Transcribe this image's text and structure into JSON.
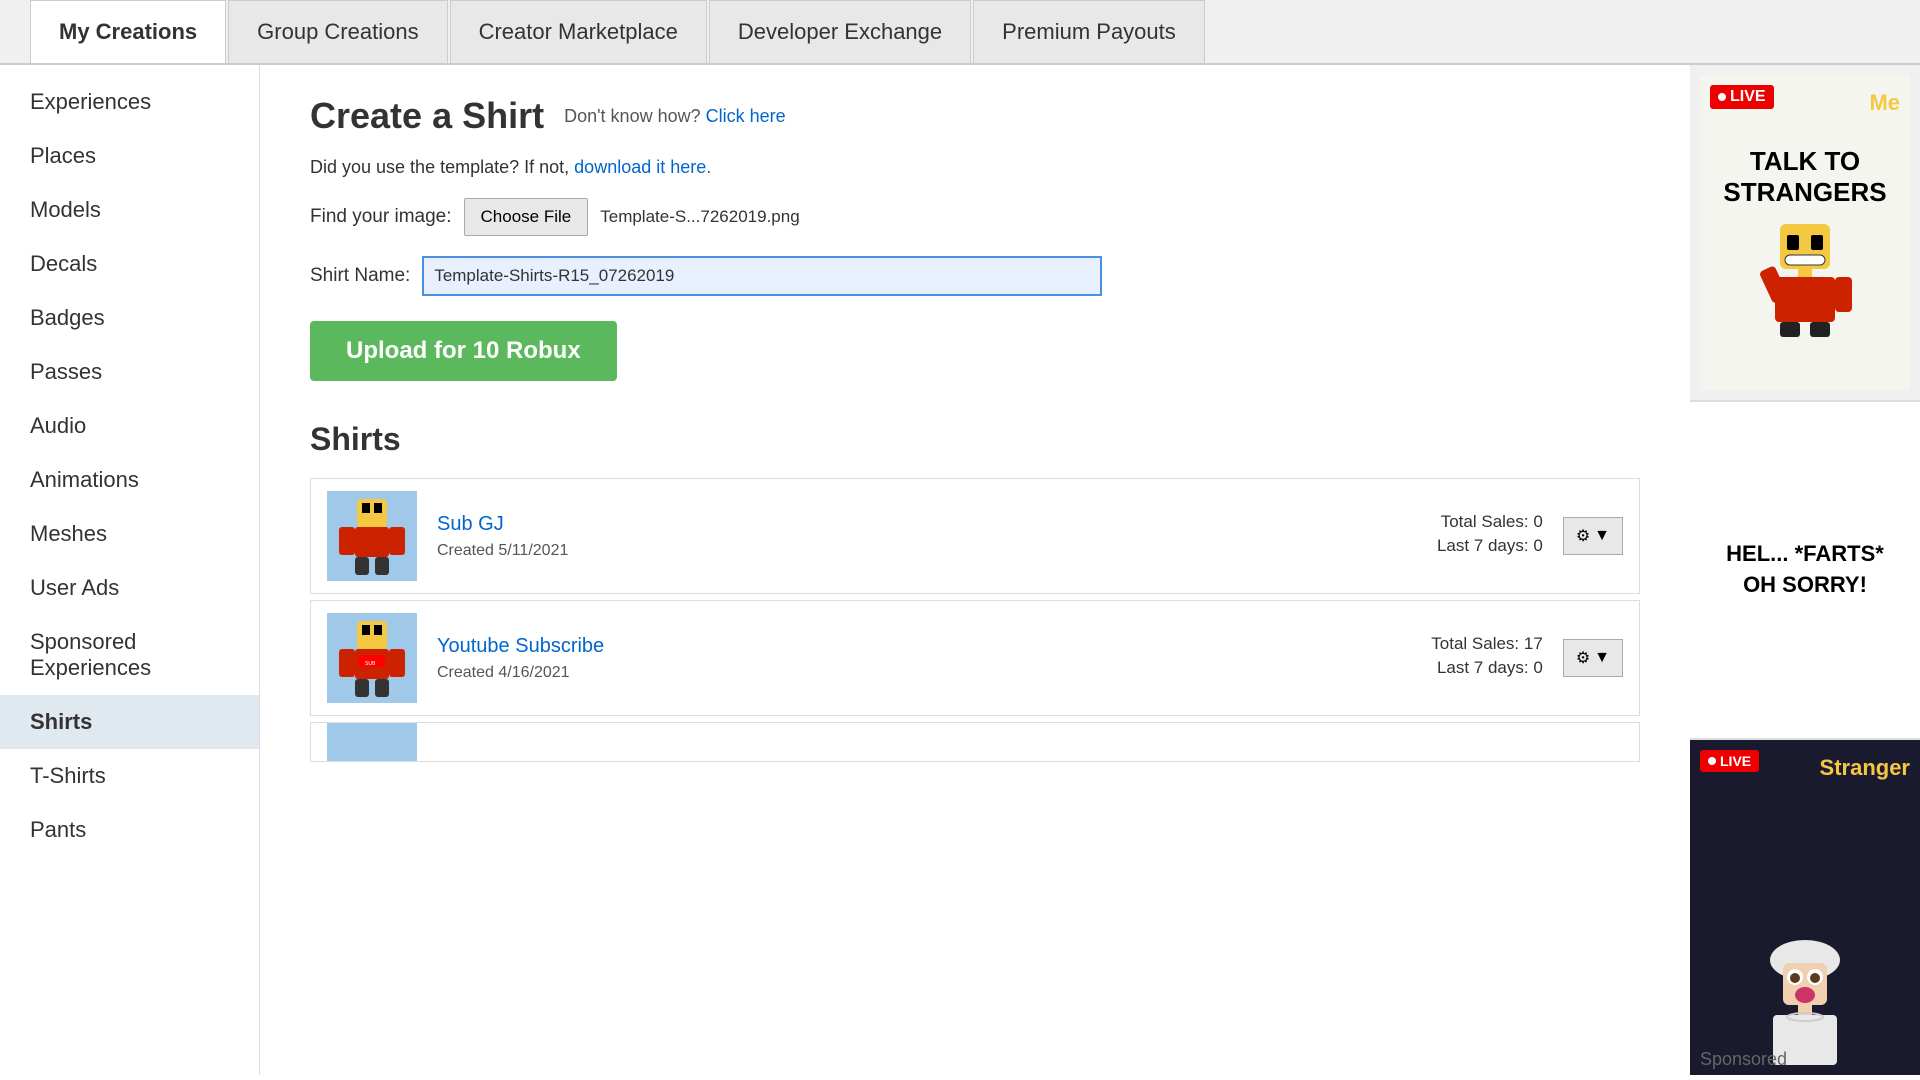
{
  "topNav": {
    "tabs": [
      {
        "label": "My Creations",
        "active": true
      },
      {
        "label": "Group Creations",
        "active": false
      },
      {
        "label": "Creator Marketplace",
        "active": false
      },
      {
        "label": "Developer Exchange",
        "active": false
      },
      {
        "label": "Premium Payouts",
        "active": false
      }
    ]
  },
  "sidebar": {
    "items": [
      {
        "label": "Experiences",
        "active": false
      },
      {
        "label": "Places",
        "active": false
      },
      {
        "label": "Models",
        "active": false
      },
      {
        "label": "Decals",
        "active": false
      },
      {
        "label": "Badges",
        "active": false
      },
      {
        "label": "Passes",
        "active": false
      },
      {
        "label": "Audio",
        "active": false
      },
      {
        "label": "Animations",
        "active": false
      },
      {
        "label": "Meshes",
        "active": false
      },
      {
        "label": "User Ads",
        "active": false
      },
      {
        "label": "Sponsored Experiences",
        "active": false
      },
      {
        "label": "Shirts",
        "active": true
      },
      {
        "label": "T-Shirts",
        "active": false
      },
      {
        "label": "Pants",
        "active": false
      }
    ]
  },
  "createShirt": {
    "title": "Create a Shirt",
    "dontKnowText": "Don't know how?",
    "clickHereLabel": "Click here",
    "templateNotice": "Did you use the template? If not,",
    "downloadLinkLabel": "download it here.",
    "findImageLabel": "Find your image:",
    "chooseFileLabel": "Choose File",
    "fileName": "Template-S...7262019.png",
    "shirtNameLabel": "Shirt Name:",
    "shirtNameValue": "Template-Shirts-R15_07262019",
    "uploadButtonLabel": "Upload for 10 Robux"
  },
  "shirtsSection": {
    "title": "Shirts",
    "items": [
      {
        "name": "Sub GJ",
        "createdLabel": "Created",
        "createdDate": "5/11/2021",
        "totalSalesLabel": "Total Sales:",
        "totalSalesValue": "0",
        "last7DaysLabel": "Last 7 days:",
        "last7DaysValue": "0"
      },
      {
        "name": "Youtube Subscribe",
        "createdLabel": "Created",
        "createdDate": "4/16/2021",
        "totalSalesLabel": "Total Sales:",
        "totalSalesValue": "17",
        "last7DaysLabel": "Last 7 days:",
        "last7DaysValue": "0"
      }
    ]
  },
  "ads": {
    "ad1": {
      "title": "TALK TO\nSTRANGERS",
      "liveBadge": "LIVE",
      "meLabel": "Me"
    },
    "ad2": {
      "line1": "HEL... *FARTS*",
      "line2": "OH SORRY!"
    },
    "ad3": {
      "liveBadge": "LIVE",
      "strangerLabel": "Stranger"
    }
  },
  "sponsoredText": "Sponsored"
}
